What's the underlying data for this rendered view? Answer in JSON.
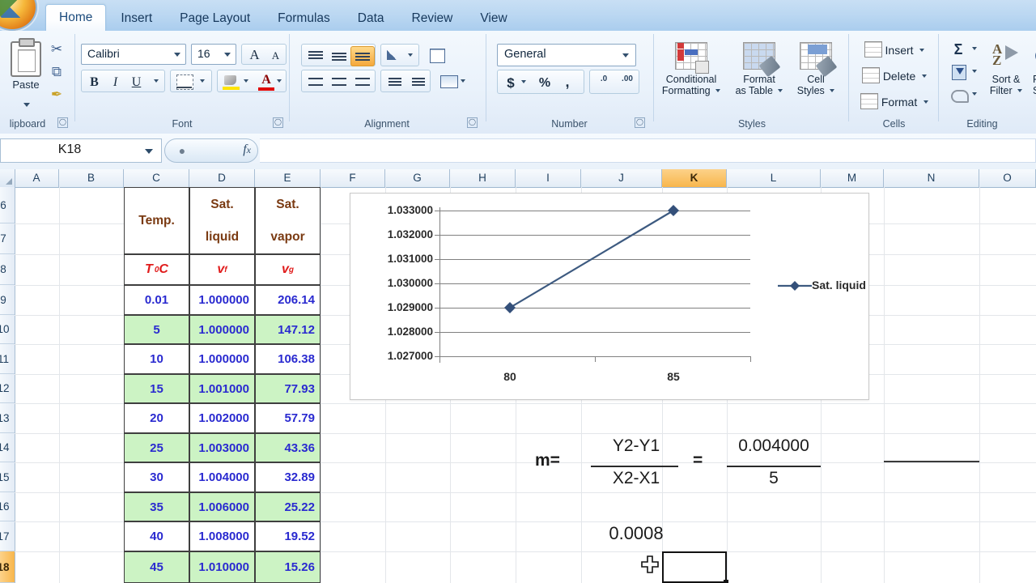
{
  "app": {
    "office_button": "office-orb",
    "active_cell": "K18",
    "formula_value": ""
  },
  "tabs": [
    {
      "label": "Home",
      "active": true
    },
    {
      "label": "Insert",
      "active": false
    },
    {
      "label": "Page Layout",
      "active": false
    },
    {
      "label": "Formulas",
      "active": false
    },
    {
      "label": "Data",
      "active": false
    },
    {
      "label": "Review",
      "active": false
    },
    {
      "label": "View",
      "active": false
    }
  ],
  "ribbon": {
    "clipboard": {
      "label": "lipboard",
      "paste": "Paste",
      "cut": "✂",
      "copy": "⧉",
      "format_painter": "✒"
    },
    "font": {
      "label": "Font",
      "font_name": "Calibri",
      "font_size": "16",
      "grow_font": "A",
      "shrink_font": "A",
      "bold": "B",
      "italic": "I",
      "underline": "U",
      "borders": "borders-icon",
      "fill_color": "fill-color-icon",
      "font_color": "A"
    },
    "alignment": {
      "label": "Alignment",
      "align_top": "align-top-icon",
      "align_middle": "align-middle-icon",
      "align_bottom": "align-bottom-icon",
      "orientation": "orientation-icon",
      "align_left": "align-left-icon",
      "align_center": "align-center-icon",
      "align_right": "align-right-icon",
      "decrease_indent": "decrease-indent-icon",
      "increase_indent": "increase-indent-icon",
      "wrap_text": "wrap-text-icon",
      "merge_center": "merge-center-icon"
    },
    "number": {
      "label": "Number",
      "format": "General",
      "currency": "$",
      "percent": "%",
      "comma": ",",
      "increase_decimal": ".0",
      "decrease_decimal": ".00"
    },
    "styles": {
      "label": "Styles",
      "conditional_formatting": "Conditional\nFormatting",
      "conditional_formatting_l1": "Conditional",
      "conditional_formatting_l2": "Formatting",
      "format_as_table_l1": "Format",
      "format_as_table_l2": "as Table",
      "cell_styles_l1": "Cell",
      "cell_styles_l2": "Styles"
    },
    "cells": {
      "label": "Cells",
      "insert": "Insert",
      "delete": "Delete",
      "format": "Format"
    },
    "editing": {
      "label": "Editing",
      "autosum": "Σ",
      "fill": "fill-icon",
      "clear": "clear-icon",
      "sort_filter_l1": "Sort &",
      "sort_filter_l2": "Filter",
      "find_select_l1": "F",
      "find_select_l2": "S"
    }
  },
  "columns": [
    "A",
    "B",
    "C",
    "D",
    "E",
    "F",
    "G",
    "H",
    "I",
    "J",
    "K",
    "L",
    "M",
    "N",
    "O"
  ],
  "selected_column": "K",
  "rows": [
    "6",
    "7",
    "8",
    "9",
    "10",
    "11",
    "12",
    "13",
    "14",
    "15",
    "16",
    "17",
    "18"
  ],
  "selected_row": "18",
  "table": {
    "headers": {
      "temp_l1": "Temp.",
      "temp_l2": "",
      "liquid_l1": "Sat.",
      "liquid_l2": "liquid",
      "vapor_l1": "Sat.",
      "vapor_l2": "vapor",
      "temp_sym": "T",
      "temp_unit": "0C",
      "vf_sym": "v",
      "vf_sub": "f",
      "vg_sym": "v",
      "vg_sub": "g"
    },
    "rows": [
      {
        "temp": "0.01",
        "vf": "1.000000",
        "vg": "206.14",
        "shaded": false
      },
      {
        "temp": "5",
        "vf": "1.000000",
        "vg": "147.12",
        "shaded": true
      },
      {
        "temp": "10",
        "vf": "1.000000",
        "vg": "106.38",
        "shaded": false
      },
      {
        "temp": "15",
        "vf": "1.001000",
        "vg": "77.93",
        "shaded": true
      },
      {
        "temp": "20",
        "vf": "1.002000",
        "vg": "57.79",
        "shaded": false
      },
      {
        "temp": "25",
        "vf": "1.003000",
        "vg": "43.36",
        "shaded": true
      },
      {
        "temp": "30",
        "vf": "1.004000",
        "vg": "32.89",
        "shaded": false
      },
      {
        "temp": "35",
        "vf": "1.006000",
        "vg": "25.22",
        "shaded": true
      },
      {
        "temp": "40",
        "vf": "1.008000",
        "vg": "19.52",
        "shaded": false
      },
      {
        "temp": "45",
        "vf": "1.010000",
        "vg": "15.26",
        "shaded": true
      }
    ]
  },
  "chart_data": {
    "type": "line",
    "title": "",
    "xlabel": "",
    "ylabel": "",
    "x": [
      80,
      85
    ],
    "categories": [
      "80",
      "85"
    ],
    "series": [
      {
        "name": "Sat. liquid",
        "values": [
          1.029,
          1.033
        ],
        "color": "#3d5a80",
        "marker": "diamond"
      }
    ],
    "ytick_labels": [
      "1.033000",
      "1.032000",
      "1.031000",
      "1.030000",
      "1.029000",
      "1.028000",
      "1.027000"
    ],
    "ytick_values": [
      1.033,
      1.032,
      1.031,
      1.03,
      1.029,
      1.028,
      1.027
    ],
    "ylim": [
      1.027,
      1.033
    ],
    "xtick_labels": [
      "80",
      "85"
    ],
    "grid": true,
    "legend_position": "right",
    "legend_entries": [
      "Sat. liquid"
    ]
  },
  "formula_block": {
    "m_label": "m=",
    "numerator": "Y2-Y1",
    "denominator": "X2-X1",
    "equals": "=",
    "result_numerator": "0.004000",
    "result_denominator": "5",
    "result": "0.0008"
  }
}
